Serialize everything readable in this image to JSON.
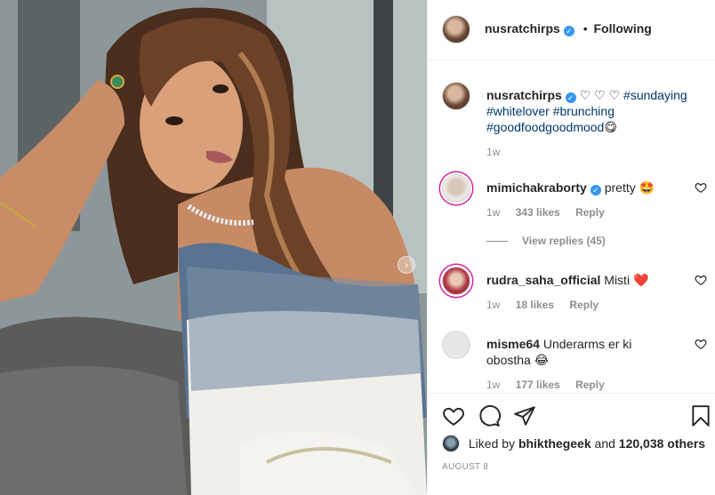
{
  "header": {
    "username": "nusratchirps",
    "separator": "•",
    "follow_status": "Following"
  },
  "caption": {
    "username": "nusratchirps",
    "hearts": "♡ ♡ ♡",
    "hashtags": [
      "#sundaying",
      "#whitelover",
      "#brunching",
      "#goodfoodgoodmood"
    ],
    "emoji": "😋",
    "time": "1w"
  },
  "comments": [
    {
      "username": "mimichakraborty",
      "verified": true,
      "text": "pretty",
      "emoji": "🤩",
      "time": "1w",
      "likes": "343 likes",
      "reply": "Reply"
    },
    {
      "username": "rudra_saha_official",
      "verified": false,
      "text": "Misti",
      "emoji": "❤️",
      "time": "1w",
      "likes": "18 likes",
      "reply": "Reply"
    },
    {
      "username": "misme64",
      "verified": false,
      "text": "Underarms er ki obostha",
      "emoji": "😂",
      "time": "1w",
      "likes": "177 likes",
      "reply": "Reply"
    }
  ],
  "view_replies": "View replies (45)",
  "likes": {
    "prefix": "Liked by",
    "user": "bhikthegeek",
    "middle": "and",
    "count": "120,038 others"
  },
  "date": "AUGUST 8",
  "colors": {
    "verified": "#3897f0",
    "hashtag": "#00376b",
    "heart_red": "#ed4956",
    "muted": "#8e8e8e"
  },
  "icons": [
    "heart-icon",
    "comment-icon",
    "share-icon",
    "bookmark-icon",
    "verified-icon",
    "carousel-next-icon"
  ]
}
